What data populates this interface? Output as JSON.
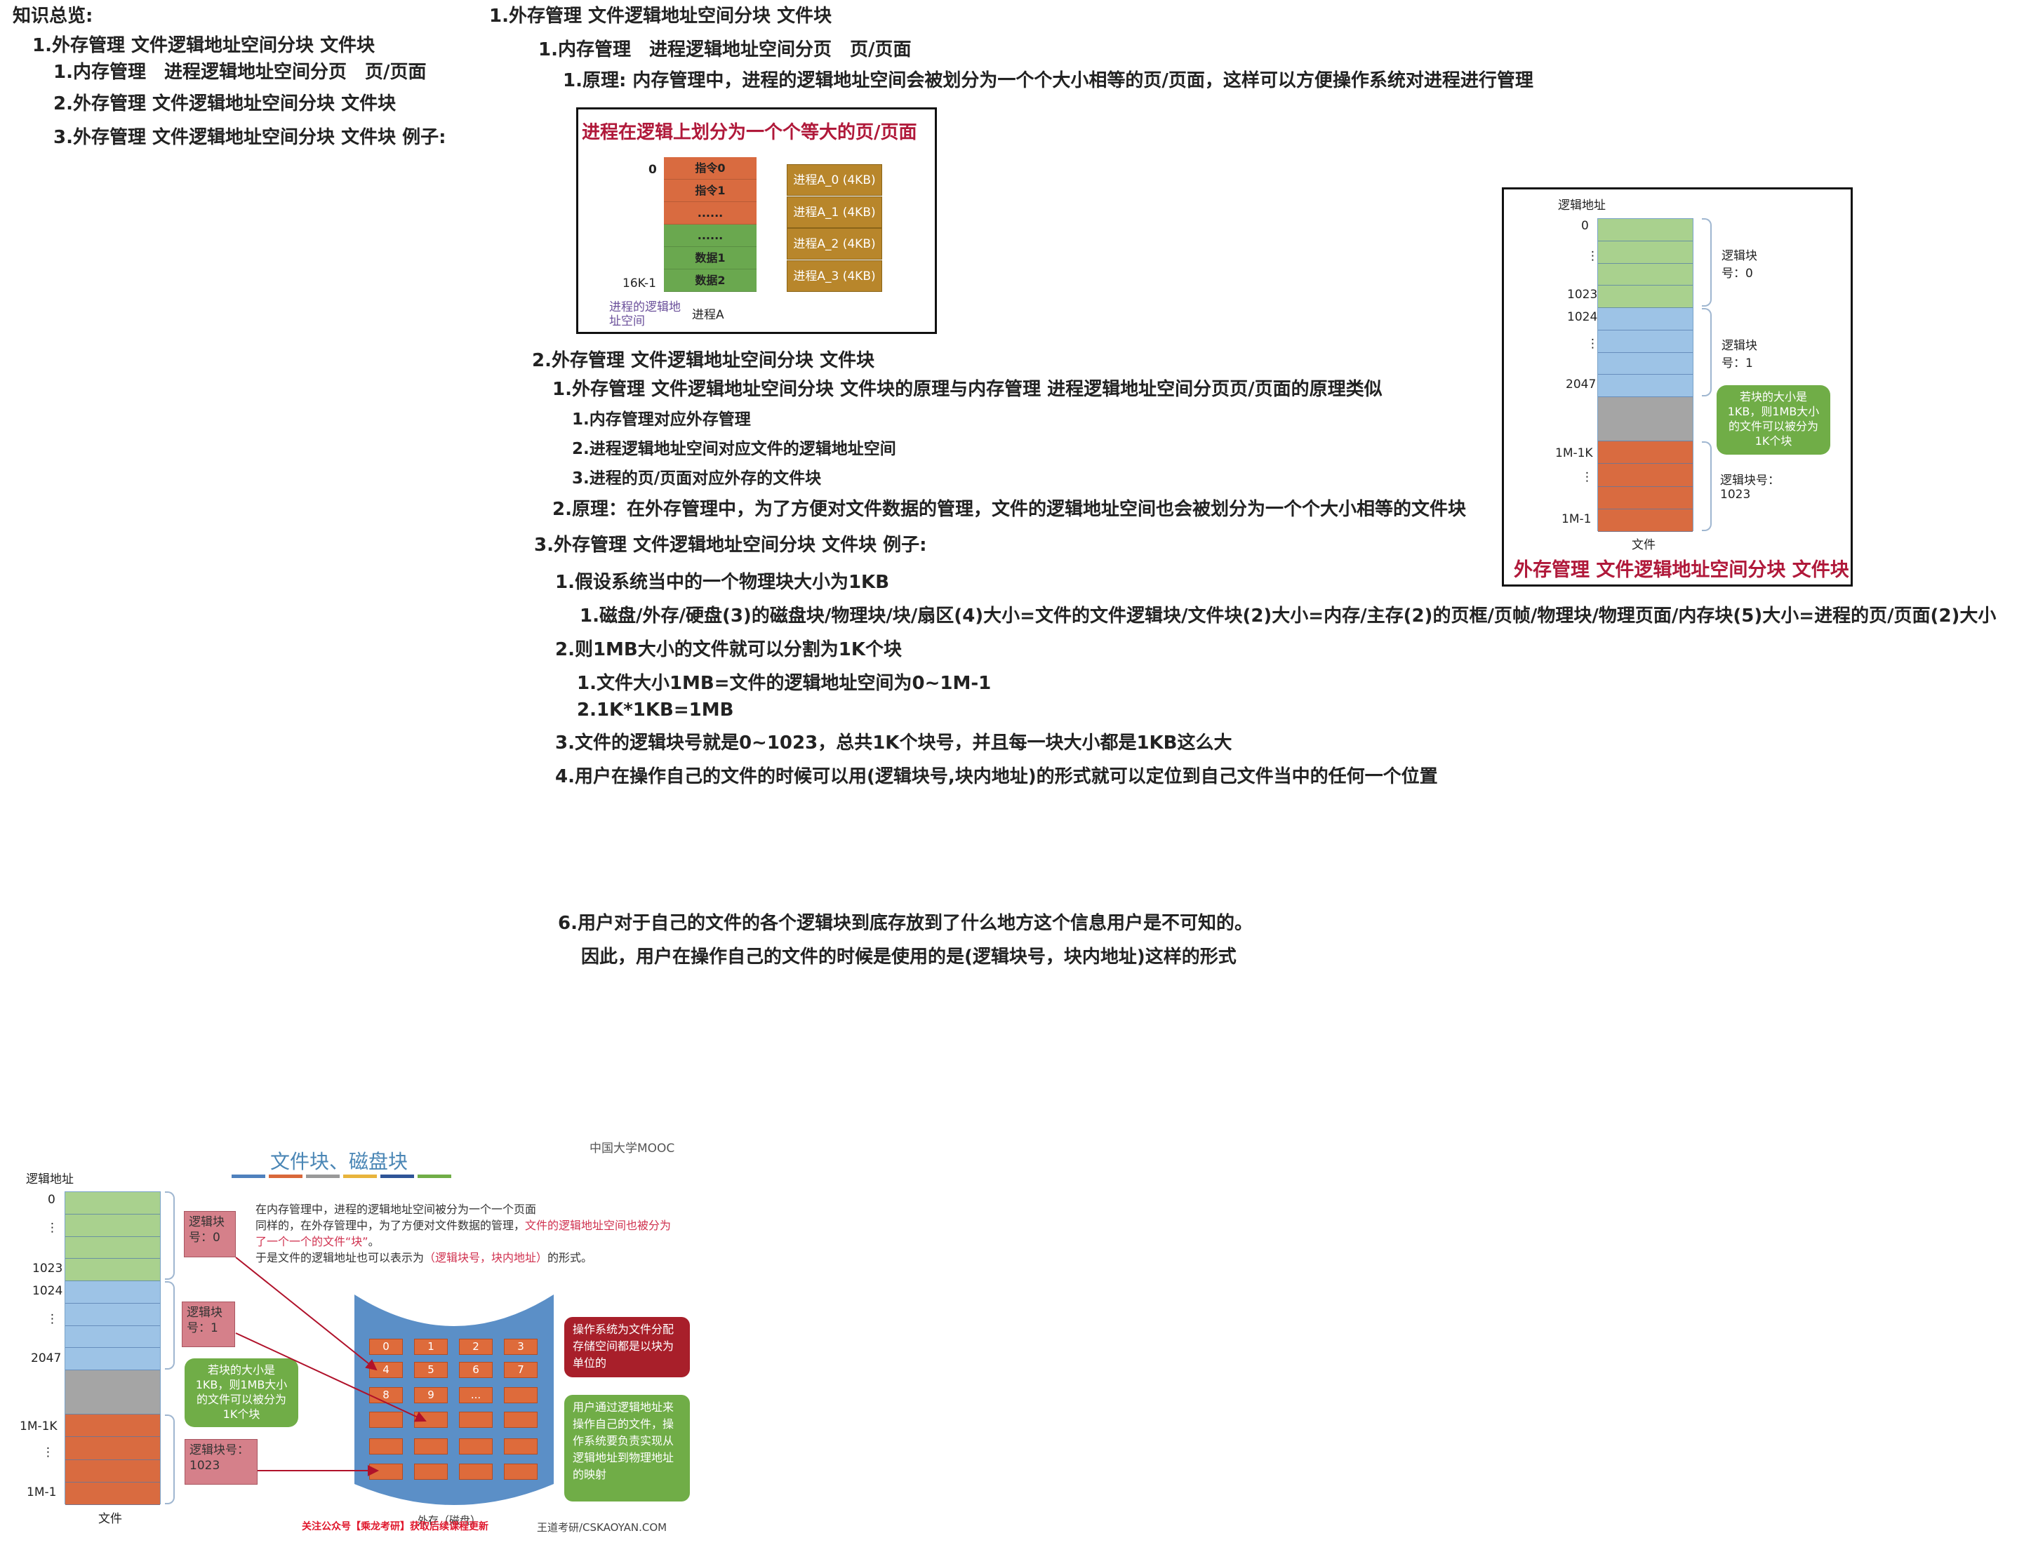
{
  "overview": {
    "title": "知识总览:",
    "items": [
      "1.外存管理 文件逻辑地址空间分块 文件块",
      "1.内存管理　进程逻辑地址空间分页　页/页面",
      "2.外存管理 文件逻辑地址空间分块 文件块",
      "3.外存管理 文件逻辑地址空间分块 文件块 例子:"
    ]
  },
  "main": {
    "h1": "1.外存管理 文件逻辑地址空间分块 文件块",
    "s1": "1.内存管理　进程逻辑地址空间分页　页/页面",
    "s1_1": "1.原理: 内存管理中，进程的逻辑地址空间会被划分为一个个大小相等的页/页面，这样可以方便操作系统对进程进行管理",
    "s2": "2.外存管理 文件逻辑地址空间分块 文件块",
    "s2_1": "1.外存管理 文件逻辑地址空间分块 文件块的原理与内存管理 进程逻辑地址空间分页页/页面的原理类似",
    "s2_1_items": [
      "1.内存管理对应外存管理",
      "2.进程逻辑地址空间对应文件的逻辑地址空间",
      "3.进程的页/页面对应外存的文件块"
    ],
    "s2_2": "2.原理：在外存管理中，为了方便对文件数据的管理，文件的逻辑地址空间也会被划分为一个个大小相等的文件块",
    "s3": "3.外存管理 文件逻辑地址空间分块 文件块 例子:",
    "s3_1": "1.假设系统当中的一个物理块大小为1KB",
    "s3_1_1": "1.磁盘/外存/硬盘(3)的磁盘块/物理块/块/扇区(4)大小=文件的文件逻辑块/文件块(2)大小=内存/主存(2)的页框/页帧/物理块/物理页面/内存块(5)大小=进程的页/页面(2)大小",
    "s3_2": "2.则1MB大小的文件就可以分割为1K个块",
    "s3_2_1": "1.文件大小1MB=文件的逻辑地址空间为0~1M-1",
    "s3_2_2": "2.1K*1KB=1MB",
    "s3_3": "3.文件的逻辑块号就是0~1023，总共1K个块号，并且每一块大小都是1KB这么大",
    "s3_4": "4.用户在操作自己的文件的时候可以用(逻辑块号,块内地址)的形式就可以定位到自己文件当中的任何一个位置",
    "s6": "6.用户对于自己的文件的各个逻辑块到底存放到了什么地方这个信息用户是不可知的。",
    "s6_b": "因此，用户在操作自己的文件的时候是使用的是(逻辑块号，块内地址)这样的形式"
  },
  "fig1": {
    "title": "进程在逻辑上划分为一个个等大的页/页面",
    "cells": [
      "指令0",
      "指令1",
      "......",
      "......",
      "数据1",
      "数据2"
    ],
    "addr_start": "0",
    "addr_end": "16K-1",
    "caption_left": "进程的逻辑地址空间",
    "caption_right": "进程A",
    "pages": [
      "进程A_0 (4KB)",
      "进程A_1 (4KB)",
      "进程A_2 (4KB)",
      "进程A_3 (4KB)"
    ]
  },
  "fig2": {
    "header": "逻辑地址",
    "addrs": [
      "0",
      "1023",
      "1024",
      "2047",
      "1M-1K",
      "1M-1"
    ],
    "block0": "逻辑块号：0",
    "block1": "逻辑块号：1",
    "block_last": "逻辑块号：1023",
    "bubble": "若块的大小是1KB，则1MB大小的文件可以被分为1K个块",
    "file_label": "文件",
    "title": "外存管理 文件逻辑地址空间分块 文件块"
  },
  "fig3": {
    "logo": "中国大学MOOC",
    "title": "文件块、磁盘块",
    "header": "逻辑地址",
    "addrs": [
      "0",
      "1023",
      "1024",
      "2047",
      "1M-1K",
      "1M-1"
    ],
    "file_label": "文件",
    "block0": "逻辑块号：0",
    "block1": "逻辑块号：1",
    "block_last": "逻辑块号：1023",
    "bubble": "若块的大小是1KB，则1MB大小的文件可以被分为1K个块",
    "para1": "在内存管理中，进程的逻辑地址空间被分为一个一个页面",
    "para2a": "同样的，在外存管理中，为了方便对文件数据的管理，",
    "para2b": "文件的逻辑地址空间也被分为了一个一个的文件“块”",
    "para2c": "。",
    "para3a": "于是文件的逻辑地址也可以表示为",
    "para3b": "（逻辑块号，块内地址）",
    "para3c": "的形式。",
    "grid": [
      "0",
      "1",
      "2",
      "3",
      "4",
      "5",
      "6",
      "7",
      "8",
      "9",
      "...",
      "",
      "",
      "",
      "",
      "",
      "",
      "",
      "",
      "",
      "",
      "",
      "",
      ""
    ],
    "callout_red": "操作系统为文件分配存储空间都是以块为单位的",
    "callout_green": "用户通过逻辑地址来操作自己的文件，操作系统要负责实现从逻辑地址到物理地址的映射",
    "disk_label": "外存（磁盘）",
    "footer_red": "关注公众号【乘龙考研】获取后续课程更新",
    "footer_site": "王道考研/CSKAOYAN.COM",
    "bar_colors": [
      "#4f81bd",
      "#d9683a",
      "#999999",
      "#e8b43c",
      "#2f5597",
      "#70ad47"
    ]
  },
  "colors": {
    "green": "#a9d18e",
    "blue": "#9dc3e6",
    "gray": "#a5a5a5",
    "orange": "#d96b40",
    "red_title": "#b0193a"
  }
}
